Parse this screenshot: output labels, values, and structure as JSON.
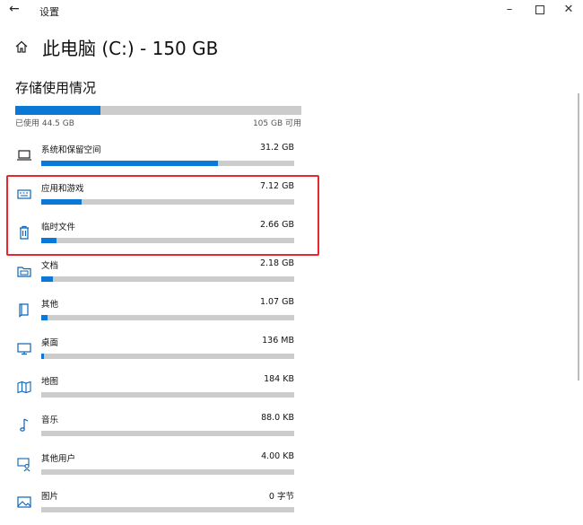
{
  "window": {
    "title": "设置",
    "back_glyph": "←",
    "min_glyph": "–",
    "close_glyph": "✕"
  },
  "header": {
    "title": "此电脑 (C:) - 150 GB",
    "home_icon": "home-icon"
  },
  "storage": {
    "section_title": "存储使用情况",
    "used_label": "已使用 44.5 GB",
    "free_label": "105 GB 可用",
    "used_fraction": 0.297,
    "bar_color": "#0a78d4",
    "track_color": "#cccccc"
  },
  "categories": [
    {
      "name": "系统和保留空间",
      "size": "31.2 GB",
      "fraction": 0.7,
      "icon": "laptop-icon"
    },
    {
      "name": "应用和游戏",
      "size": "7.12 GB",
      "fraction": 0.16,
      "icon": "keyboard-icon"
    },
    {
      "name": "临时文件",
      "size": "2.66 GB",
      "fraction": 0.06,
      "icon": "trash-icon"
    },
    {
      "name": "文档",
      "size": "2.18 GB",
      "fraction": 0.045,
      "icon": "folder-icon"
    },
    {
      "name": "其他",
      "size": "1.07 GB",
      "fraction": 0.025,
      "icon": "book-icon"
    },
    {
      "name": "桌面",
      "size": "136 MB",
      "fraction": 0.004,
      "icon": "monitor-icon"
    },
    {
      "name": "地图",
      "size": "184 KB",
      "fraction": 0,
      "icon": "map-icon"
    },
    {
      "name": "音乐",
      "size": "88.0 KB",
      "fraction": 0,
      "icon": "music-note-icon"
    },
    {
      "name": "其他用户",
      "size": "4.00 KB",
      "fraction": 0,
      "icon": "other-user-icon"
    },
    {
      "name": "图片",
      "size": "0 字节",
      "fraction": 0,
      "icon": "picture-icon"
    }
  ],
  "annotation": {
    "highlight_color": "#e8282c"
  }
}
